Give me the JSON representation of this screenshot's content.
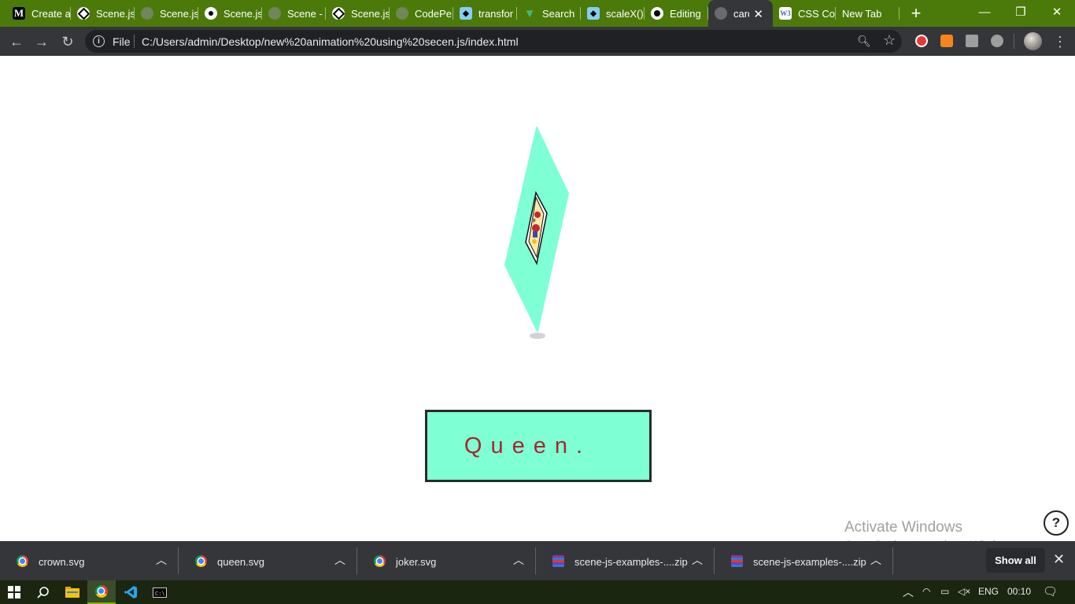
{
  "browser": {
    "tabs": [
      {
        "title": "Create a",
        "icon": "medium-icon"
      },
      {
        "title": "Scene.js",
        "icon": "codepen-icon"
      },
      {
        "title": "Scene.js",
        "icon": "globe-icon"
      },
      {
        "title": "Scene.js",
        "icon": "scenejs-icon"
      },
      {
        "title": "Scene -",
        "icon": "globe-icon"
      },
      {
        "title": "Scene.js",
        "icon": "codepen-icon"
      },
      {
        "title": "CodePe",
        "icon": "globe-icon"
      },
      {
        "title": "transfor",
        "icon": "mdn-icon"
      },
      {
        "title": "Search",
        "icon": "vue-icon"
      },
      {
        "title": "scaleX()",
        "icon": "mdn-icon"
      },
      {
        "title": "Editing",
        "icon": "github-icon"
      },
      {
        "title": "card",
        "icon": "globe-icon"
      },
      {
        "title": "CSS Col",
        "icon": "w3schools-icon"
      },
      {
        "title": "New Tab",
        "icon": ""
      }
    ],
    "address": {
      "scheme": "File",
      "url": "C:/Users/admin/Desktop/new%20animation%20using%20secen.js/index.html"
    }
  },
  "page": {
    "card_label": "Queen.",
    "colors": {
      "card_face": "#7fffd4",
      "label_text": "#a52a2a",
      "label_border": "#2a2a2a"
    },
    "activate_title": "Activate Windows",
    "activate_sub": "Go to Settings to activate Windows.",
    "help_label": "?"
  },
  "downloads": {
    "items": [
      {
        "name": "crown.svg",
        "icon": "chrome-icon"
      },
      {
        "name": "queen.svg",
        "icon": "chrome-icon"
      },
      {
        "name": "joker.svg",
        "icon": "chrome-icon"
      },
      {
        "name": "scene-js-examples-....zip",
        "icon": "winrar-icon"
      },
      {
        "name": "scene-js-examples-....zip",
        "icon": "winrar-icon"
      }
    ],
    "show_all": "Show all"
  },
  "taskbar": {
    "language": "ENG",
    "time": "00:10"
  }
}
